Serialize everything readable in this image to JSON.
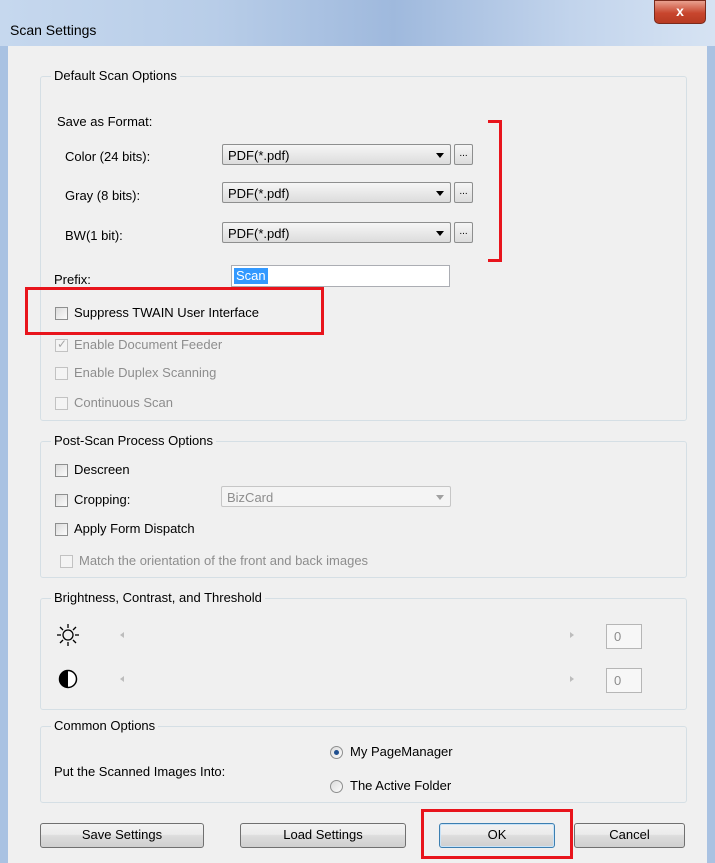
{
  "window": {
    "title": "Scan Settings",
    "close_glyph": "x"
  },
  "default_scan": {
    "group_title": "Default Scan Options",
    "save_as_label": "Save as Format:",
    "rows": [
      {
        "label": "Color (24 bits):",
        "value": "PDF(*.pdf)"
      },
      {
        "label": "Gray (8 bits):",
        "value": "PDF(*.pdf)"
      },
      {
        "label": "BW(1 bit):",
        "value": "PDF(*.pdf)"
      }
    ],
    "ellipsis": "...",
    "prefix_label": "Prefix:",
    "prefix_value": "Scan",
    "suppress_twain": {
      "label": "Suppress TWAIN User Interface",
      "checked": false
    },
    "enable_feeder": {
      "label": "Enable Document Feeder",
      "checked": true,
      "disabled": true
    },
    "enable_duplex": {
      "label": "Enable Duplex Scanning",
      "checked": false,
      "disabled": true
    },
    "continuous": {
      "label": "Continuous Scan",
      "checked": false,
      "disabled": true
    }
  },
  "post_scan": {
    "group_title": "Post-Scan Process Options",
    "descreen": "Descreen",
    "cropping": "Cropping:",
    "cropping_value": "BizCard",
    "apply_form": "Apply Form Dispatch",
    "match_orientation": "Match the orientation of the front and back images"
  },
  "brightness": {
    "group_title": "Brightness, Contrast, and Threshold",
    "brightness_value": "0",
    "contrast_value": "0",
    "brightness_icon": "sun-icon",
    "contrast_icon": "contrast-icon"
  },
  "common": {
    "group_title": "Common Options",
    "put_label": "Put the Scanned Images Into:",
    "options": [
      "My PageManager",
      "The Active Folder"
    ],
    "selected": "My PageManager"
  },
  "buttons": {
    "save": "Save Settings",
    "load": "Load Settings",
    "ok": "OK",
    "cancel": "Cancel"
  },
  "colors": {
    "highlight": "#e8141c",
    "selection": "#3399ff"
  }
}
